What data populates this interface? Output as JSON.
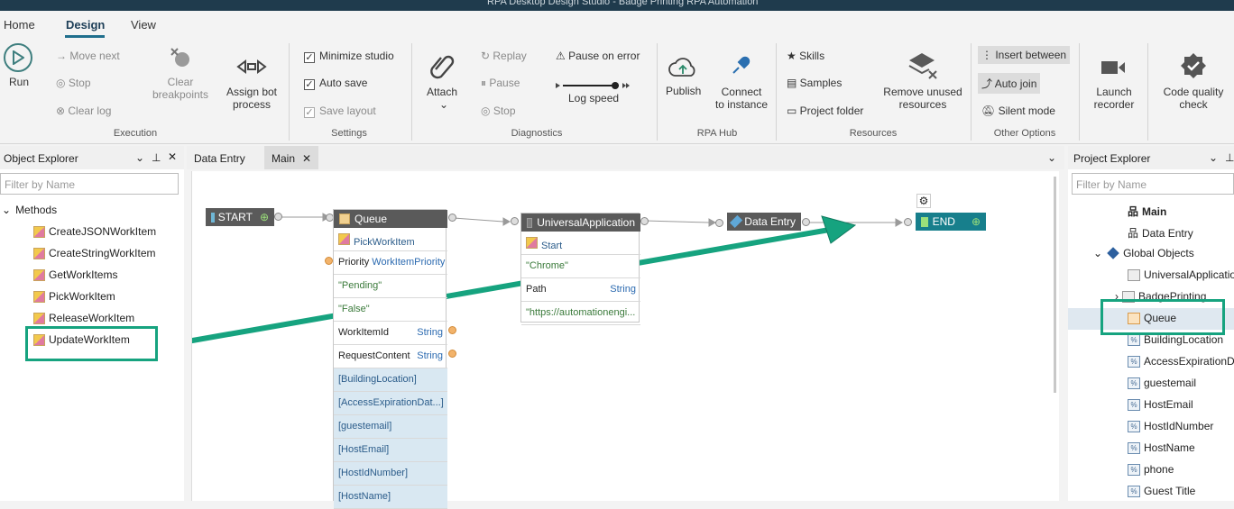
{
  "window": {
    "title": "RPA Desktop Design Studio - Badge Printing RPA Automation"
  },
  "menu": {
    "tabs": [
      "Home",
      "Design",
      "View"
    ]
  },
  "ribbon": {
    "run": "Run",
    "move_next": "Move next",
    "stop": "Stop",
    "clear_log": "Clear log",
    "clear_breakpoints": "Clear\nbreakpoints",
    "assign_bot_process": "Assign bot\nprocess",
    "minimize_studio": "Minimize studio",
    "auto_save": "Auto save",
    "save_layout": "Save layout",
    "attach": "Attach",
    "replay": "Replay",
    "pause": "Pause",
    "stop_diag": "Stop",
    "pause_on_error": "Pause on error",
    "log_speed": "Log speed",
    "publish": "Publish",
    "connect_to_instance": "Connect\nto instance",
    "skills": "Skills",
    "samples": "Samples",
    "project_folder": "Project folder",
    "remove_unused_resources": "Remove unused\nresources",
    "insert_between": "Insert between",
    "auto_join": "Auto join",
    "silent_mode": "Silent mode",
    "launch_recorder": "Launch\nrecorder",
    "code_quality_check": "Code quality\ncheck",
    "groups": {
      "execution": "Execution",
      "settings": "Settings",
      "diagnostics": "Diagnostics",
      "rpa_hub": "RPA Hub",
      "resources": "Resources",
      "other_options": "Other Options"
    }
  },
  "object_explorer": {
    "title": "Object Explorer",
    "filter_placeholder": "Filter by Name",
    "root": "Methods",
    "items": [
      "CreateJSONWorkItem",
      "CreateStringWorkItem",
      "GetWorkItems",
      "PickWorkItem",
      "ReleaseWorkItem",
      "UpdateWorkItem"
    ]
  },
  "canvas": {
    "tabs": [
      "Data Entry",
      "Main"
    ],
    "start": "START",
    "end": "END",
    "queue": {
      "title": "Queue",
      "method": "PickWorkItem",
      "priority_label": "Priority",
      "priority_value": "WorkItemPriority",
      "pending": "\"Pending\"",
      "false_val": "\"False\"",
      "workitemid": "WorkItemId",
      "requestcontent": "RequestContent",
      "type": "String",
      "fields": [
        "[BuildingLocation]",
        "[AccessExpirationDat...]",
        "[guestemail]",
        "[HostEmail]",
        "[HostIdNumber]",
        "[HostName]"
      ]
    },
    "universal": {
      "title": "UniversalApplication",
      "method": "Start",
      "chrome": "\"Chrome\"",
      "path": "Path",
      "type": "String",
      "url": "\"https://automationengi..."
    },
    "data_entry": "Data Entry"
  },
  "project_explorer": {
    "title": "Project Explorer",
    "filter_placeholder": "Filter by Name",
    "items": [
      "Main",
      "Data Entry",
      "Global Objects",
      "UniversalApplication",
      "BadgePrinting",
      "Queue",
      "BuildingLocation",
      "AccessExpirationDa",
      "guestemail",
      "HostEmail",
      "HostIdNumber",
      "HostName",
      "phone",
      "Guest Title"
    ]
  },
  "colors": {
    "accent": "#16a37f",
    "node_dark": "#5a5a5a",
    "end_teal": "#177f8c"
  }
}
